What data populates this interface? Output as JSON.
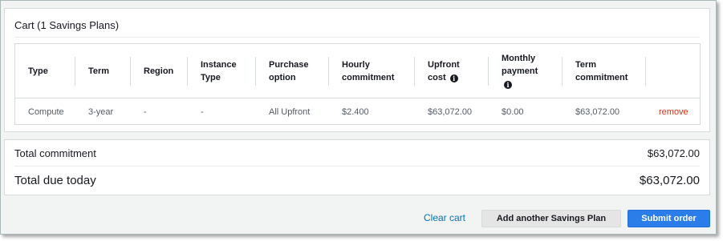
{
  "cart": {
    "title": "Cart (1 Savings Plans)",
    "columns": [
      {
        "line1": "Type",
        "line2": ""
      },
      {
        "line1": "Term",
        "line2": ""
      },
      {
        "line1": "Region",
        "line2": ""
      },
      {
        "line1": "Instance",
        "line2": "Type"
      },
      {
        "line1": "Purchase",
        "line2": "option"
      },
      {
        "line1": "Hourly",
        "line2": "commitment"
      },
      {
        "line1": "Upfront",
        "line2": "cost"
      },
      {
        "line1": "Monthly",
        "line2": "payment"
      },
      {
        "line1": "Term",
        "line2": "commitment"
      }
    ],
    "info_icon_glyph": "i",
    "rows": [
      {
        "type": "Compute",
        "term": "3-year",
        "region": "-",
        "instance_type": "-",
        "purchase_option": "All Upfront",
        "hourly_commitment": "$2.400",
        "upfront_cost": "$63,072.00",
        "monthly_payment": "$0.00",
        "term_commitment": "$63,072.00",
        "remove_label": "remove"
      }
    ]
  },
  "totals": {
    "commitment_label": "Total commitment",
    "commitment_value": "$63,072.00",
    "due_label": "Total due today",
    "due_value": "$63,072.00"
  },
  "actions": {
    "clear_cart": "Clear cart",
    "add_another": "Add another Savings Plan",
    "submit": "Submit order"
  },
  "colors": {
    "link": "#0073bb",
    "remove": "#d13212",
    "primary_button": "#2b7de9",
    "secondary_button": "#e5e5e5"
  }
}
